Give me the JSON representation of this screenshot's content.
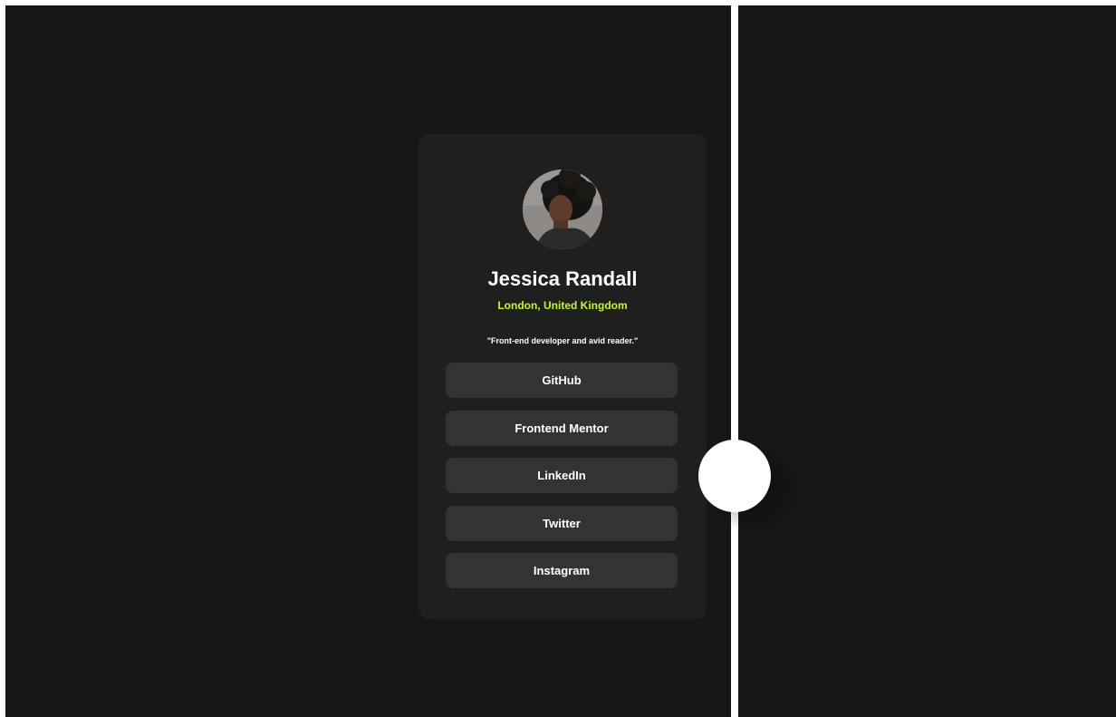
{
  "profile": {
    "name": "Jessica Randall",
    "location": "London, United Kingdom",
    "bio": "\"Front-end developer and avid reader.\""
  },
  "links": [
    {
      "label": "GitHub"
    },
    {
      "label": "Frontend Mentor"
    },
    {
      "label": "LinkedIn"
    },
    {
      "label": "Twitter"
    },
    {
      "label": "Instagram"
    }
  ],
  "colors": {
    "page_background": "#161616",
    "card_background": "#1f1f1f",
    "button_background": "#333333",
    "accent": "#c4f82a",
    "text": "#ffffff",
    "divider": "#ffffff"
  },
  "comparison_slider": {
    "handle_icon": "circle-handle"
  }
}
